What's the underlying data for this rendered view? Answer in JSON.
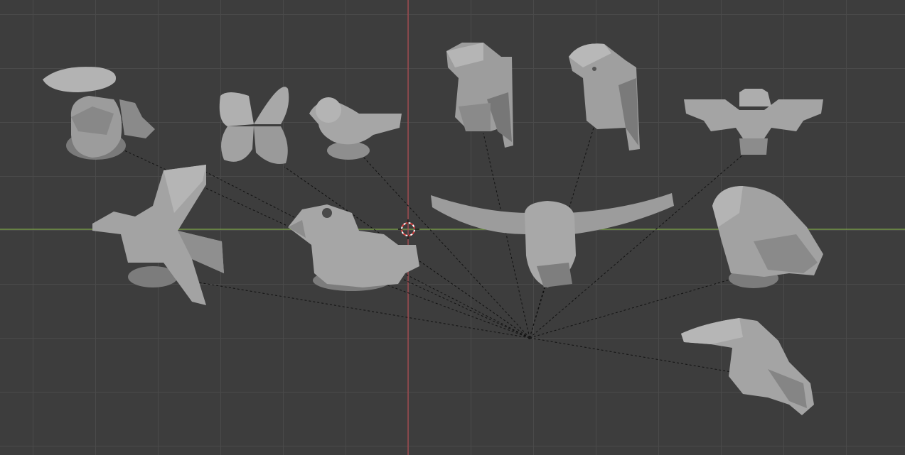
{
  "viewport": {
    "app": "3D viewport",
    "mode": "solid",
    "colors": {
      "background": "#3d3d3d",
      "grid": "#4a4a4a",
      "x_axis": "#80a84a",
      "y_axis": "#b44a50",
      "model": "#9c9c9c",
      "model_dark": "#6e6e6e",
      "model_light": "#bdbdbd",
      "relationship_line": "#111111",
      "cursor_ring": "#d94040"
    }
  },
  "objects": [
    {
      "id": "object-bird-pelican",
      "shape": "capped bird"
    },
    {
      "id": "object-butterfly",
      "shape": "butterfly"
    },
    {
      "id": "object-sparrow",
      "shape": "small bird"
    },
    {
      "id": "object-parrot-1",
      "shape": "parrot"
    },
    {
      "id": "object-parrot-2",
      "shape": "parrot"
    },
    {
      "id": "object-bat",
      "shape": "bat"
    },
    {
      "id": "object-dove-flying",
      "shape": "flying bird"
    },
    {
      "id": "object-chick",
      "shape": "chick"
    },
    {
      "id": "object-owl-spread",
      "shape": "owl with spread wings"
    },
    {
      "id": "object-crow",
      "shape": "perched bird"
    },
    {
      "id": "object-toucan",
      "shape": "toucan"
    }
  ],
  "scene_cursor": {
    "name": "3d-cursor"
  }
}
